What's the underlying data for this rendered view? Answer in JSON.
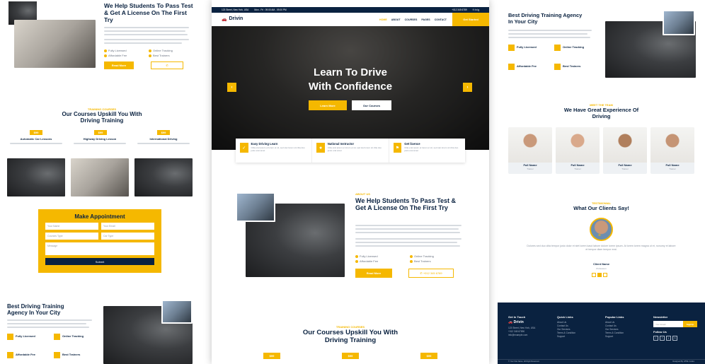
{
  "left": {
    "about_title": "We Help Students To Pass Test & Get A License On The First Try",
    "checks": [
      "Fully Licensed",
      "Online Tracking",
      "Affordable Fee",
      "Best Trainers"
    ],
    "read_more": "Read More",
    "course_tag": "TRAINING COURSES",
    "courses_title": "Our Courses Upskill You With Driving Training",
    "course_prices": [
      "$99",
      "$99",
      "$99"
    ],
    "course_names": [
      "Automatic Car Lessons",
      "Highway Driving Lesson",
      "International Driving"
    ],
    "appointment": {
      "title": "Make Appointment",
      "fields": [
        "Your Name",
        "Your Email",
        "Courses Type",
        "Car Type",
        "Message"
      ],
      "submit": "Submit"
    },
    "agency_title": "Best Driving Training Agency In Your City",
    "agency_features": [
      "Fully Licensed",
      "Online Tracking",
      "Affordable Fee",
      "Best Trainers"
    ]
  },
  "center": {
    "topbar": {
      "address": "123 Street, New York, USA",
      "hours": "Mon - Fri : 09.00 AM - 09.00 PM",
      "phone": "+012 345 6789"
    },
    "brand": "Drivin",
    "nav": [
      "HOME",
      "ABOUT",
      "COURSES",
      "PAGES",
      "CONTACT"
    ],
    "cta": "Get Started",
    "hero": {
      "title_line1": "Learn To Drive",
      "title_line2": "With Confidence",
      "btn_primary": "Learn More",
      "btn_secondary": "Our Courses"
    },
    "features": [
      {
        "title": "Easy Driving Learn",
        "text": "Clita erat ipsum et lorem et sit, sed stet lorem sit clita duo justo erat amet"
      },
      {
        "title": "National Instructor",
        "text": "Clita erat ipsum et lorem et sit, sed stet lorem sit clita duo justo erat amet"
      },
      {
        "title": "Get licence",
        "text": "Clita erat ipsum et lorem et sit, sed stet lorem sit clita duo justo erat amet"
      }
    ],
    "about": {
      "tag": "ABOUT US",
      "title": "We Help Students To Pass Test & Get A License On The First Try",
      "checks": [
        "Fully Licensed",
        "Online Tracking",
        "Affordable Fee",
        "Best Trainers"
      ],
      "read_more": "Read More",
      "phone": "+012 345 6789"
    },
    "courses": {
      "tag": "TRAINING COURSES",
      "title": "Our Courses Upskill You With Driving Training",
      "prices": [
        "$99",
        "$99",
        "$99"
      ]
    }
  },
  "right": {
    "agency_title": "Best Driving Training Agency In Your City",
    "agency_features": [
      "Fully Licensed",
      "Online Tracking",
      "Affordable Fee",
      "Best Trainers"
    ],
    "team_tag": "MEET THE TEAM",
    "team_title": "We Have Great Experience Of Driving",
    "team": [
      {
        "name": "Full Name",
        "role": "Trainer"
      },
      {
        "name": "Full Name",
        "role": "Trainer"
      },
      {
        "name": "Full Name",
        "role": "Trainer"
      },
      {
        "name": "Full Name",
        "role": "Trainer"
      }
    ],
    "testimonial_tag": "TESTIMONIAL",
    "testimonial_title": "What Our Clients Say!",
    "testimonial_text": "Dolores sed duo clita tempor justo dolor et stet lorem kasd labore dolore lorem ipsum. At lorem lorem magna ut et, nonumy et labore et tempor diam tempor erat.",
    "client_name": "Client Name",
    "client_role": "Profession",
    "footer": {
      "cols": [
        "Get In Touch",
        "Quick Links",
        "Popular Links",
        "Newsletter"
      ],
      "brand": "Drivin",
      "contact": [
        "123 Street, New York, USA",
        "+012 345 67890",
        "info@example.com"
      ],
      "quick": [
        "About Us",
        "Contact Us",
        "Our Services",
        "Terms & Condition",
        "Support"
      ],
      "popular": [
        "About Us",
        "Contact Us",
        "Our Services",
        "Terms & Condition",
        "Support"
      ],
      "newsletter_placeholder": "Your Email",
      "signup": "SignUp",
      "follow": "Follow Us",
      "copyright": "© Your Site Name, All Right Reserved.",
      "designed": "Designed By HTML Codex"
    }
  },
  "colors": {
    "accent": "#f5b800",
    "navy": "#0a2240"
  }
}
